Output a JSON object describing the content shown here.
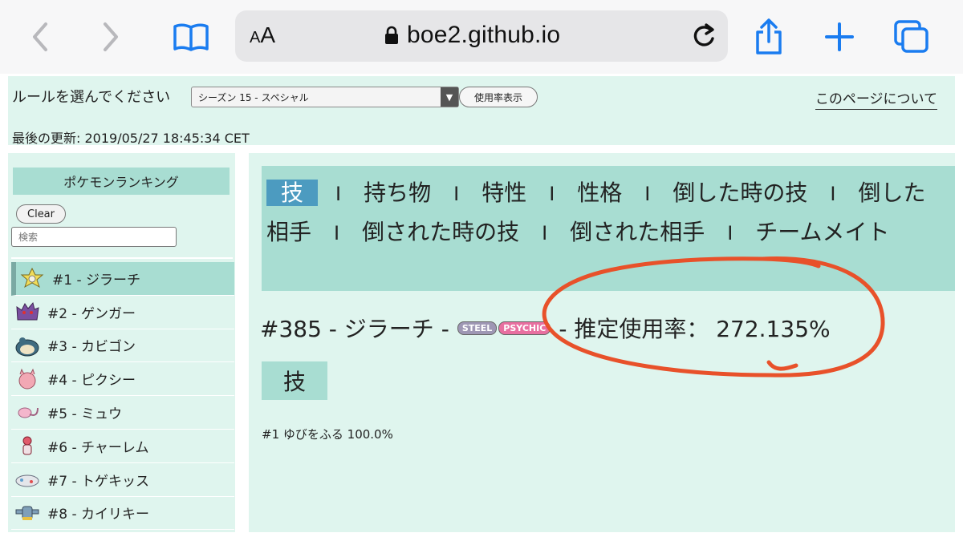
{
  "browser": {
    "aa_small": "A",
    "aa_big": "A",
    "url": "boe2.github.io"
  },
  "header": {
    "rule_label": "ルールを選んでください",
    "rule_selected": "シーズン 15 - スペシャル",
    "usage_button": "使用率表示",
    "about_link": "このページについて",
    "last_updated": "最後の更新: 2019/05/27 18:45:34 CET"
  },
  "sidebar": {
    "title": "ポケモンランキング",
    "clear_label": "Clear",
    "search_placeholder": "検索",
    "items": [
      {
        "label": "#1 - ジラーチ",
        "icon": "jirachi-sprite-icon",
        "color": "#e8d24c"
      },
      {
        "label": "#2 - ゲンガー",
        "icon": "gengar-sprite-icon",
        "color": "#7a4fa0"
      },
      {
        "label": "#3 - カビゴン",
        "icon": "snorlax-sprite-icon",
        "color": "#3f6b80"
      },
      {
        "label": "#4 - ピクシー",
        "icon": "clefable-sprite-icon",
        "color": "#f2a8b4"
      },
      {
        "label": "#5 - ミュウ",
        "icon": "mew-sprite-icon",
        "color": "#f4b6cc"
      },
      {
        "label": "#6 - チャーレム",
        "icon": "medicham-sprite-icon",
        "color": "#e05a6a"
      },
      {
        "label": "#7 - トゲキッス",
        "icon": "togekiss-sprite-icon",
        "color": "#e4e6ea"
      },
      {
        "label": "#8 - カイリキー",
        "icon": "machamp-sprite-icon",
        "color": "#7f9fb8"
      }
    ]
  },
  "main": {
    "tabs": [
      {
        "label": "技",
        "active": true
      },
      {
        "label": "持ち物"
      },
      {
        "label": "特性"
      },
      {
        "label": "性格"
      },
      {
        "label": "倒した時の技"
      },
      {
        "label": "倒した相手"
      },
      {
        "label": "倒された時の技"
      },
      {
        "label": "倒された相手"
      },
      {
        "label": "チームメイト"
      }
    ],
    "tab_separator": "I",
    "headline": {
      "name": "#385 - ジラーチ -",
      "type1": "STEEL",
      "type2": "PSYCHIC",
      "usage": "- 推定使用率： 272.135%"
    },
    "section_title": "技",
    "moves": [
      "#1 ゆびをふる 100.0%"
    ]
  },
  "colors": {
    "panel": "#dff5ee",
    "accent": "#a8ddd2",
    "active_tab": "#4c9bc0",
    "annotation": "#e8512a",
    "safari_blue": "#1a7cf0"
  }
}
